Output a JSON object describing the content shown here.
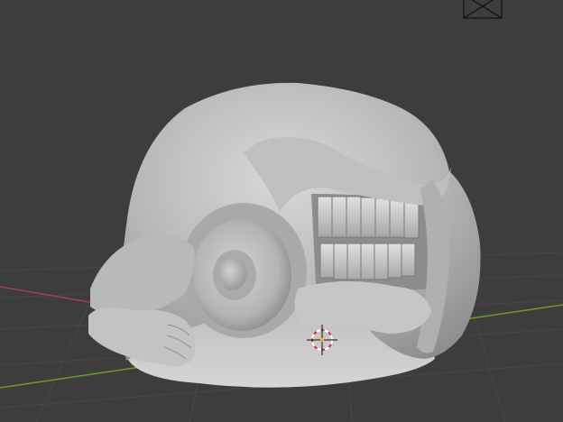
{
  "viewport": {
    "background": "#3d3d3d",
    "grid_color": "#474747",
    "x_axis_color": "#a3414f",
    "y_axis_color": "#6f9a2e",
    "sculpt_color": "#c9c9c9"
  },
  "icons": {
    "camera": "camera-icon",
    "cursor": "3d-cursor-icon"
  }
}
